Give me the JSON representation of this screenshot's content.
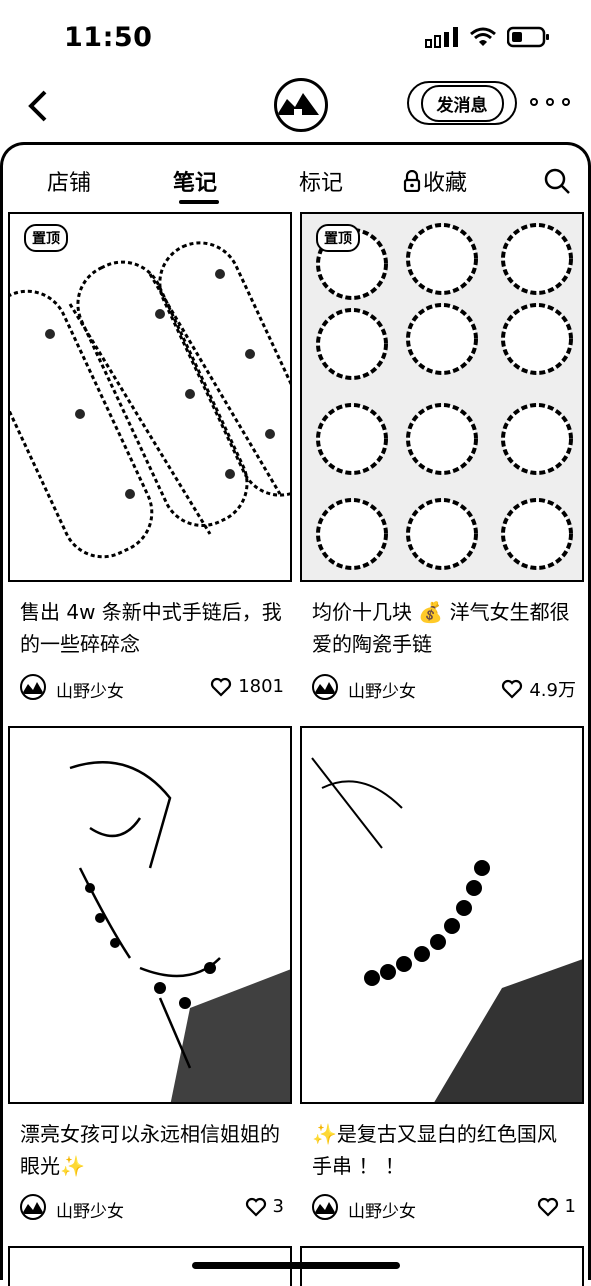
{
  "status_bar": {
    "time": "11:50"
  },
  "nav": {
    "send_message_label": "发消息"
  },
  "tabs": [
    {
      "label": "店铺"
    },
    {
      "label": "笔记"
    },
    {
      "label": "标记"
    },
    {
      "label": "收藏"
    }
  ],
  "notes": [
    {
      "pinned": "置顶",
      "title": "售出 4w 条新中式手链后，我的一些碎碎念",
      "author": "山野少女",
      "likes": "1801"
    },
    {
      "pinned": "置顶",
      "title": "均价十几块 💰 洋气女生都很爱的陶瓷手链",
      "author": "山野少女",
      "likes": "4.9万"
    },
    {
      "title": "漂亮女孩可以永远相信姐姐的眼光✨",
      "author": "山野少女",
      "likes": "3"
    },
    {
      "title": "✨是复古又显白的红色国风手串 ！ ！",
      "author": "山野少女",
      "likes": "1"
    }
  ],
  "icons": {
    "back": "chevron-left-icon",
    "more": "more-dots-icon",
    "search": "search-icon",
    "lock": "lock-icon",
    "heart": "heart-icon"
  }
}
